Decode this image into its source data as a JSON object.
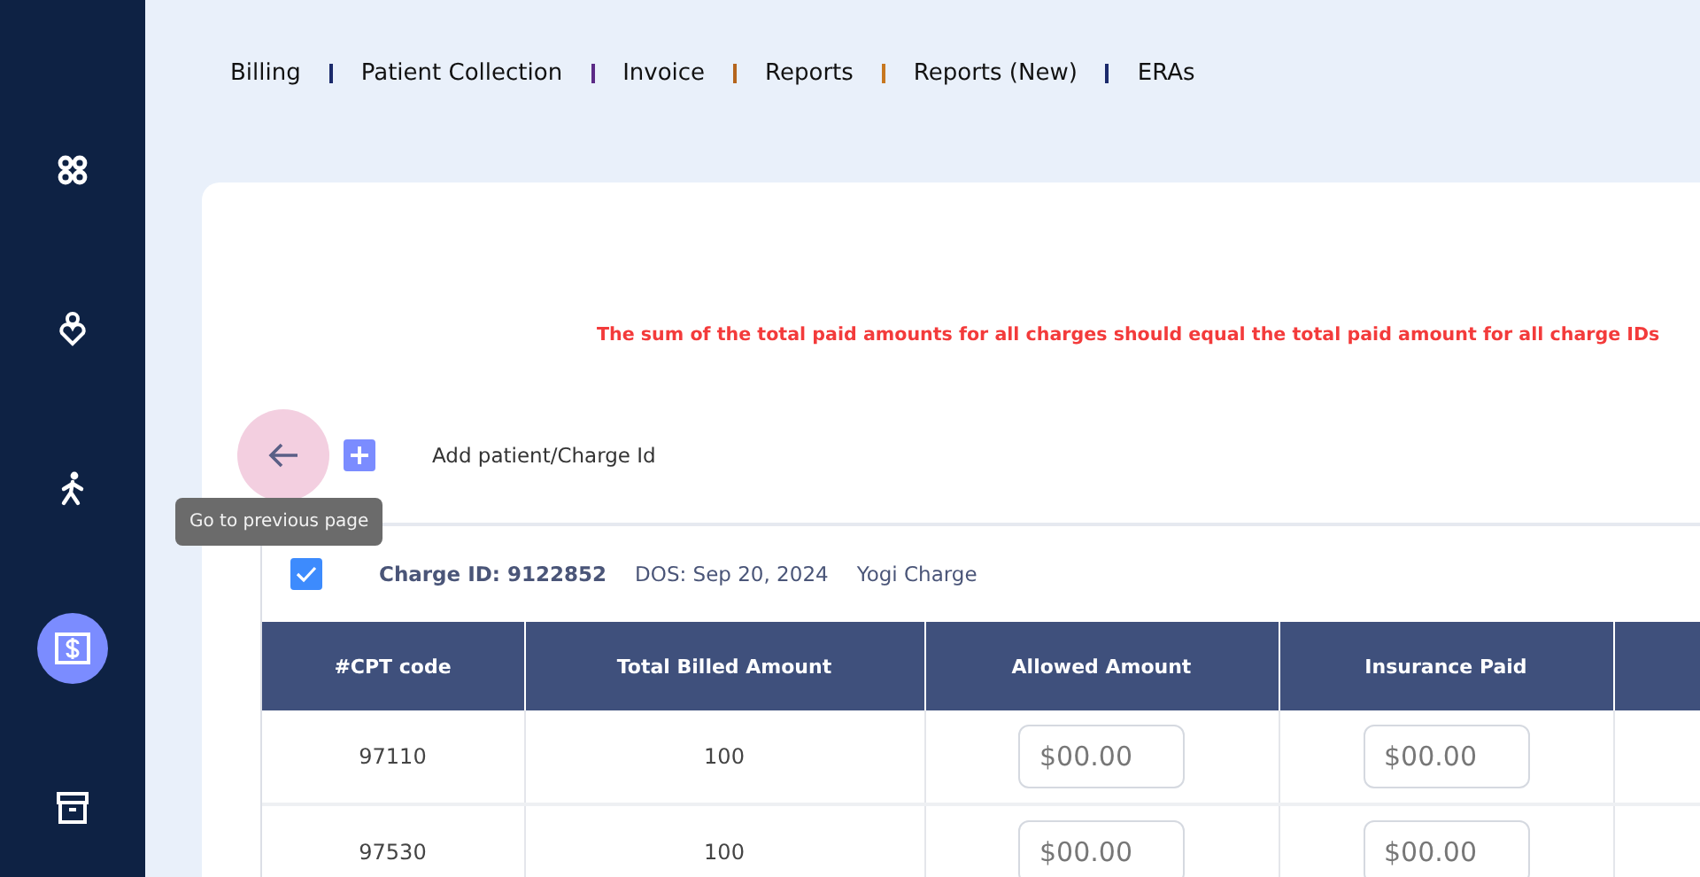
{
  "sidebar": {
    "items": [
      {
        "selected": false
      },
      {
        "selected": false
      },
      {
        "selected": false
      },
      {
        "selected": true
      },
      {
        "selected": false
      }
    ]
  },
  "nav": [
    {
      "label": "Billing",
      "color": "#1b2a6b"
    },
    {
      "label": "Patient Collection",
      "color": "#5b2a86"
    },
    {
      "label": "Invoice",
      "color": "#b5651d"
    },
    {
      "label": "Reports",
      "color": "#c7771f"
    },
    {
      "label": "Reports (New)",
      "color": "#1b2a6b"
    },
    {
      "label": "ERAs"
    }
  ],
  "warning": "The sum of the total paid amounts for all charges should equal the total paid amount for all charge IDs",
  "add_label": "Add patient/Charge Id",
  "tooltip": "Go to previous page",
  "charge": {
    "checked": true,
    "id": "Charge ID: 9122852",
    "dos": "DOS: Sep 20, 2024",
    "type": "Yogi Charge"
  },
  "table": {
    "columns": [
      "#CPT code",
      "Total Billed Amount",
      "Allowed Amount",
      "Insurance Paid"
    ],
    "rows": [
      {
        "cpt": "97110",
        "billed": "100",
        "allowed_placeholder": "$00.00",
        "paid_placeholder": "$00.00"
      },
      {
        "cpt": "97530",
        "billed": "100",
        "allowed_placeholder": "$00.00",
        "paid_placeholder": "$00.00"
      }
    ]
  }
}
